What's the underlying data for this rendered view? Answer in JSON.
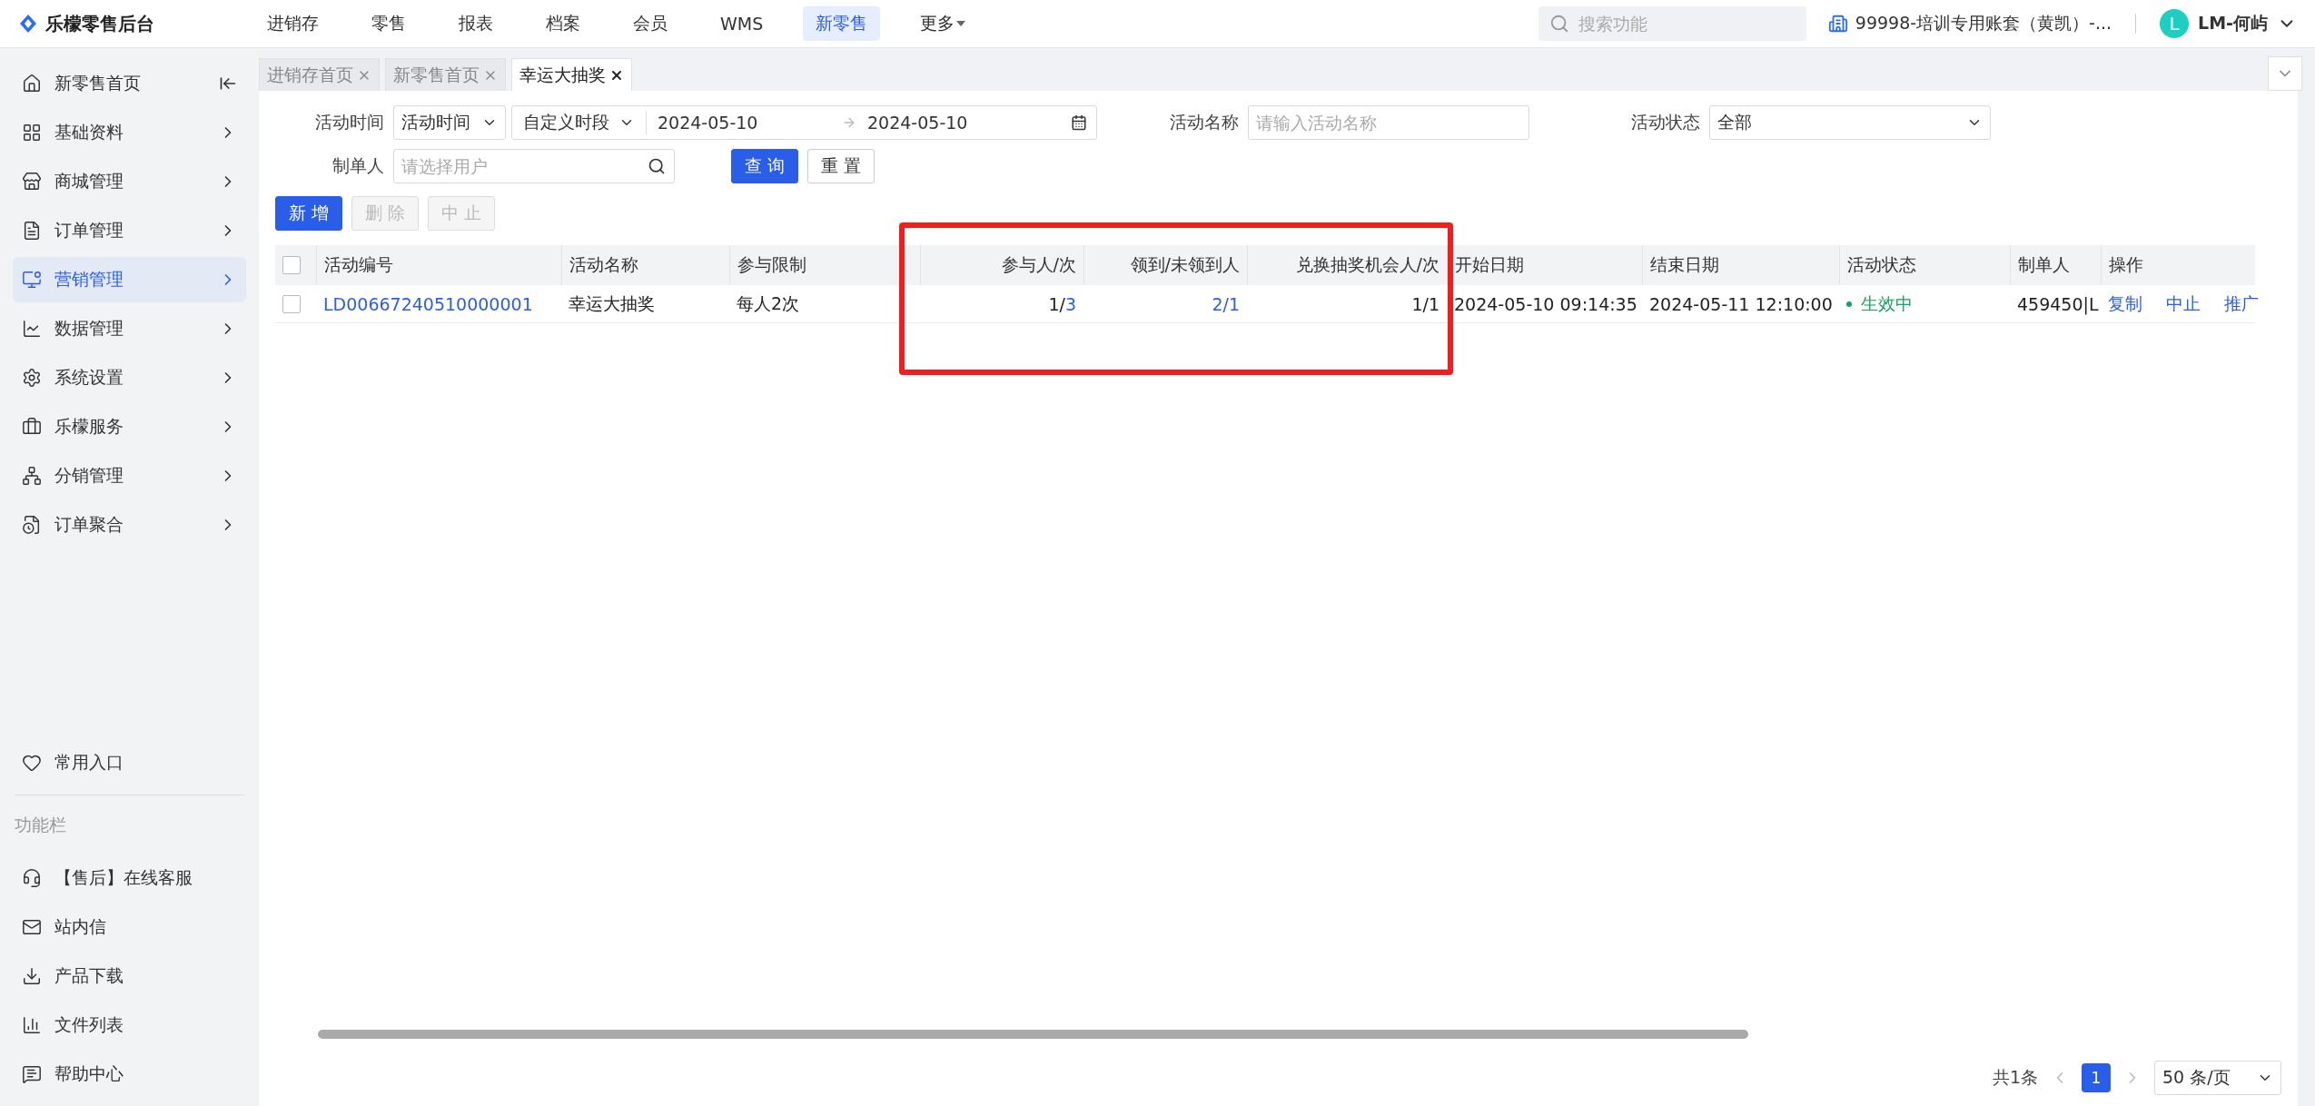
{
  "brand": {
    "name": "乐檬零售后台"
  },
  "top_nav": [
    {
      "label": "进销存",
      "selected": false
    },
    {
      "label": "零售",
      "selected": false
    },
    {
      "label": "报表",
      "selected": false
    },
    {
      "label": "档案",
      "selected": false
    },
    {
      "label": "会员",
      "selected": false
    },
    {
      "label": "WMS",
      "selected": false
    },
    {
      "label": "新零售",
      "selected": true
    },
    {
      "label": "更多",
      "selected": false,
      "dropdown": true
    }
  ],
  "header": {
    "search": {
      "placeholder": "搜索功能"
    },
    "account": "99998-培训专用账套（黄凯）-...",
    "avatar_letter": "L",
    "user": "LM-何屿"
  },
  "sidebar": {
    "items": [
      {
        "label": "新零售首页",
        "selected": false,
        "kind": "home"
      },
      {
        "label": "基础资料",
        "selected": false,
        "kind": "menu"
      },
      {
        "label": "商城管理",
        "selected": false,
        "kind": "menu"
      },
      {
        "label": "订单管理",
        "selected": false,
        "kind": "menu"
      },
      {
        "label": "营销管理",
        "selected": true,
        "kind": "menu"
      },
      {
        "label": "数据管理",
        "selected": false,
        "kind": "menu"
      },
      {
        "label": "系统设置",
        "selected": false,
        "kind": "menu"
      },
      {
        "label": "乐檬服务",
        "selected": false,
        "kind": "menu"
      },
      {
        "label": "分销管理",
        "selected": false,
        "kind": "menu"
      },
      {
        "label": "订单聚合",
        "selected": false,
        "kind": "menu"
      }
    ],
    "favorites": {
      "label": "常用入口"
    },
    "section_title": "功能栏",
    "tools": [
      {
        "label": "【售后】在线客服"
      },
      {
        "label": "站内信"
      },
      {
        "label": "产品下载"
      },
      {
        "label": "文件列表"
      },
      {
        "label": "帮助中心"
      }
    ]
  },
  "page_tabs": [
    {
      "label": "进销存首页",
      "selected": false
    },
    {
      "label": "新零售首页",
      "selected": false
    },
    {
      "label": "幸运大抽奖",
      "selected": true
    }
  ],
  "filters": {
    "time_label": "活动时间",
    "time_type": "活动时间",
    "range_type": "自定义时段",
    "date_from": "2024-05-10",
    "date_to": "2024-05-10",
    "name_label": "活动名称",
    "name_placeholder": "请输入活动名称",
    "status_label": "活动状态",
    "status_value": "全部",
    "creator_label": "制单人",
    "creator_placeholder": "请选择用户",
    "query": "查 询",
    "reset": "重 置"
  },
  "actions": [
    {
      "label": "新 增",
      "disabled": false
    },
    {
      "label": "删 除",
      "disabled": true
    },
    {
      "label": "中 止",
      "disabled": true
    }
  ],
  "table": {
    "all_checked": false,
    "columns": [
      {
        "label": "活动编号"
      },
      {
        "label": "活动名称"
      },
      {
        "label": "参与限制"
      },
      {
        "label": "参与人/次"
      },
      {
        "label": "领到/未领到人"
      },
      {
        "label": "兑换抽奖机会人/次"
      },
      {
        "label": "开始日期"
      },
      {
        "label": "结束日期"
      },
      {
        "label": "活动状态"
      },
      {
        "label": "制单人"
      },
      {
        "label": "操作"
      }
    ],
    "rows": [
      {
        "checked": false,
        "cells": [
          {
            "kind": "link",
            "text": "LD00667240510000001"
          },
          {
            "kind": "text",
            "text": "幸运大抽奖"
          },
          {
            "kind": "text",
            "text": "每人2次"
          },
          {
            "kind": "parts",
            "parts": [
              {
                "text": "1/",
                "link": false
              },
              {
                "text": "3",
                "link": true
              }
            ]
          },
          {
            "kind": "parts",
            "parts": [
              {
                "text": "2/1",
                "link": true
              }
            ]
          },
          {
            "kind": "parts",
            "parts": [
              {
                "text": "1/1",
                "link": false
              }
            ]
          },
          {
            "kind": "text",
            "text": "2024-05-10 09:14:35"
          },
          {
            "kind": "text",
            "text": "2024-05-11 12:10:00"
          },
          {
            "kind": "status",
            "text": "生效中",
            "color": "#19a15f"
          },
          {
            "kind": "text",
            "text": "459450|L"
          },
          {
            "kind": "ops",
            "ops": [
              "复制",
              "中止",
              "推广"
            ]
          }
        ]
      }
    ]
  },
  "pagination": {
    "total": "共1条",
    "pages": [
      {
        "label": "1",
        "selected": true
      }
    ],
    "page_size": "50 条/页"
  }
}
